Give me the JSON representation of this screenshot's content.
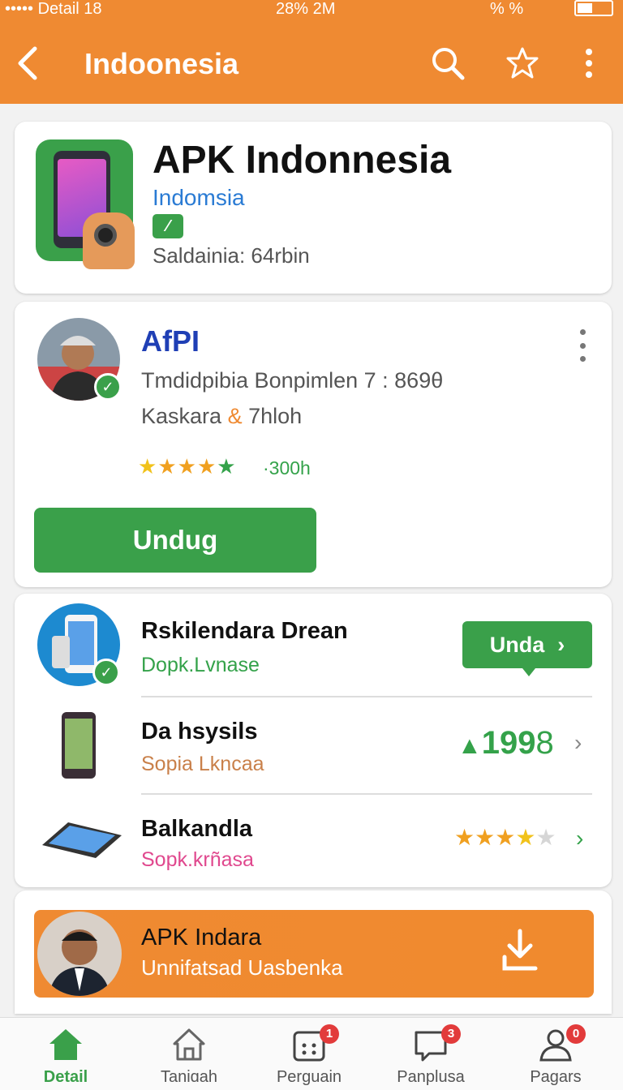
{
  "status_bar": {
    "left": "••••• Detail 18",
    "center": "28% 2M",
    "right": "% %"
  },
  "app_bar": {
    "title": "Indoonesia",
    "back_icon": "back-arrow-icon",
    "search_icon": "search-icon",
    "star_icon": "star-icon",
    "more_icon": "more-vertical-icon"
  },
  "app_header": {
    "title": "APK Indonnesia",
    "subtitle": "Indomsia",
    "badge": "⁄",
    "size_text": "Saldainia: 64rbin"
  },
  "developer": {
    "name": "AfPI",
    "line1": "Tmdidpibia Bonpimlen 7 : 869θ",
    "line2_a": "Kaskara ",
    "line2_amp": "&",
    "line2_b": " 7hloh",
    "rating_count": "·300h",
    "download_label": "Unduɡ",
    "rating_stars": 5
  },
  "list": {
    "item1": {
      "title": "Rskilendara Drean",
      "subtitle": "Dopk.Lvnase",
      "subtitle_color": "#34a24a",
      "button_label": "Unda"
    },
    "item2": {
      "title": "Da hsysils",
      "subtitle": "Sopia Lkncaa",
      "subtitle_color": "#c9804a",
      "value": "199",
      "value_suffix": "8"
    },
    "item3": {
      "title": "Balkandla",
      "subtitle": "Sopk.krñasa",
      "subtitle_color": "#e0488e",
      "rating": 3.5
    }
  },
  "promo": {
    "title": "APK Indara",
    "subtitle": "Unnifatsad Uasbenka",
    "icon": "download-icon"
  },
  "bottom_nav": [
    {
      "label": "Detail",
      "icon": "home-icon",
      "active": true
    },
    {
      "label": "Taniɑah",
      "icon": "house-outline-icon"
    },
    {
      "label": "Perguain",
      "icon": "calendar-icon",
      "badge": "1"
    },
    {
      "label": "Panplusa",
      "icon": "chat-icon",
      "badge": "3"
    },
    {
      "label": "Pagars",
      "icon": "profile-icon",
      "badge": "0"
    }
  ],
  "colors": {
    "accent": "#ef8a32",
    "green": "#3aa04a",
    "blue": "#1f3fb5"
  }
}
